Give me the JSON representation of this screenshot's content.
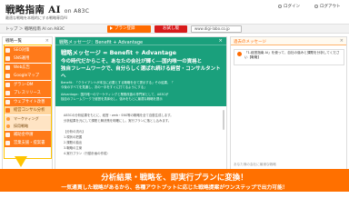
{
  "header": {
    "logo_title": "戦略指南 AI",
    "logo_suffix": "on A83C",
    "tagline": "最適な戦略を本格的にする戦略専用AI",
    "login_label": "ログイン",
    "logout_label": "ログアウト"
  },
  "topbar": {
    "breadcrumb": "トップ ＞ 戦略指南 AI on A83C",
    "plan_label": "プラン登録",
    "limit_label": "お試し版",
    "url_value": "www.digi-labo.co.jp"
  },
  "sidebar": {
    "title": "戦略一覧",
    "close": "×",
    "items": [
      {
        "label": "SEO対策"
      },
      {
        "label": "SNS運用"
      },
      {
        "label": "Web広告"
      },
      {
        "label": "Googleマップ"
      },
      {
        "label": "グラン-DM"
      },
      {
        "label": "プレスリリース"
      },
      {
        "label": "ウェブサイト改善"
      }
    ],
    "selected_item": "経営コンサル分析",
    "subitems": [
      {
        "label": "マーケティング"
      },
      {
        "label": "採用戦略"
      }
    ],
    "bottom_items": [
      {
        "label": "補助金申請"
      },
      {
        "label": "営業支援・提案書"
      }
    ]
  },
  "main": {
    "panel_title": "戦略メッセージ：Benefit + Advantage",
    "close": "×",
    "hero_title": "戦略メッセージ = Benefit + Advantage",
    "hero_line1": "今の時代だからこそ、あなたの会社が輝く──国内唯一の資格と",
    "hero_line2": "独自フレームワークで、自分らしく選ばれ続ける経営・コンサルタント",
    "hero_line3": "へ",
    "benefit_text": "Benefit：「クライアントが本当に必要とする戦略を全て提示する」その結果、「",
    "benefit_text2": "今後のすべてを見通し、次の一手をすぐに打てるようにする」",
    "advantage_text": "Advantage：国内唯一のマーケティングと業務改善の専門家として、A83Cが",
    "advantage_text2": "独自のフレームワークで経営を具体化し、強みをもとに最適な戦略を提示",
    "body_lines": [
      "A83Cの分析結果をもとに、経営・web・SNS等の戦略を全て自動生成します。",
      "分析結果を元にして課題と解決策を明確にし、実行プランに落とし込みます。",
      "",
      "【分析の流れ】",
      "1.現状の把握",
      "2.課題の抽出",
      "3.戦略の立案",
      "4.実行プラン（行動計画の作成）"
    ]
  },
  "right": {
    "title": "過去のメッセージ",
    "close": "×",
    "item_text": "「1.経営指南 AI」を使って、自社の強みと課題を分析してください【戦略】",
    "foot": "あなた様の会社に最適な戦略"
  },
  "banner": {
    "line1": "分析結果・戦略を、即実行プランに変換！",
    "line2": "一気通貫した戦略があるから、各種アウトプットに応じた戦略提案がワンステップで出力可能！"
  },
  "colors": {
    "accent_orange": "#ff7000",
    "green_panel": "#1aa07c",
    "limit_red": "#d81b1b",
    "highlight_yellow": "#ffc400"
  }
}
